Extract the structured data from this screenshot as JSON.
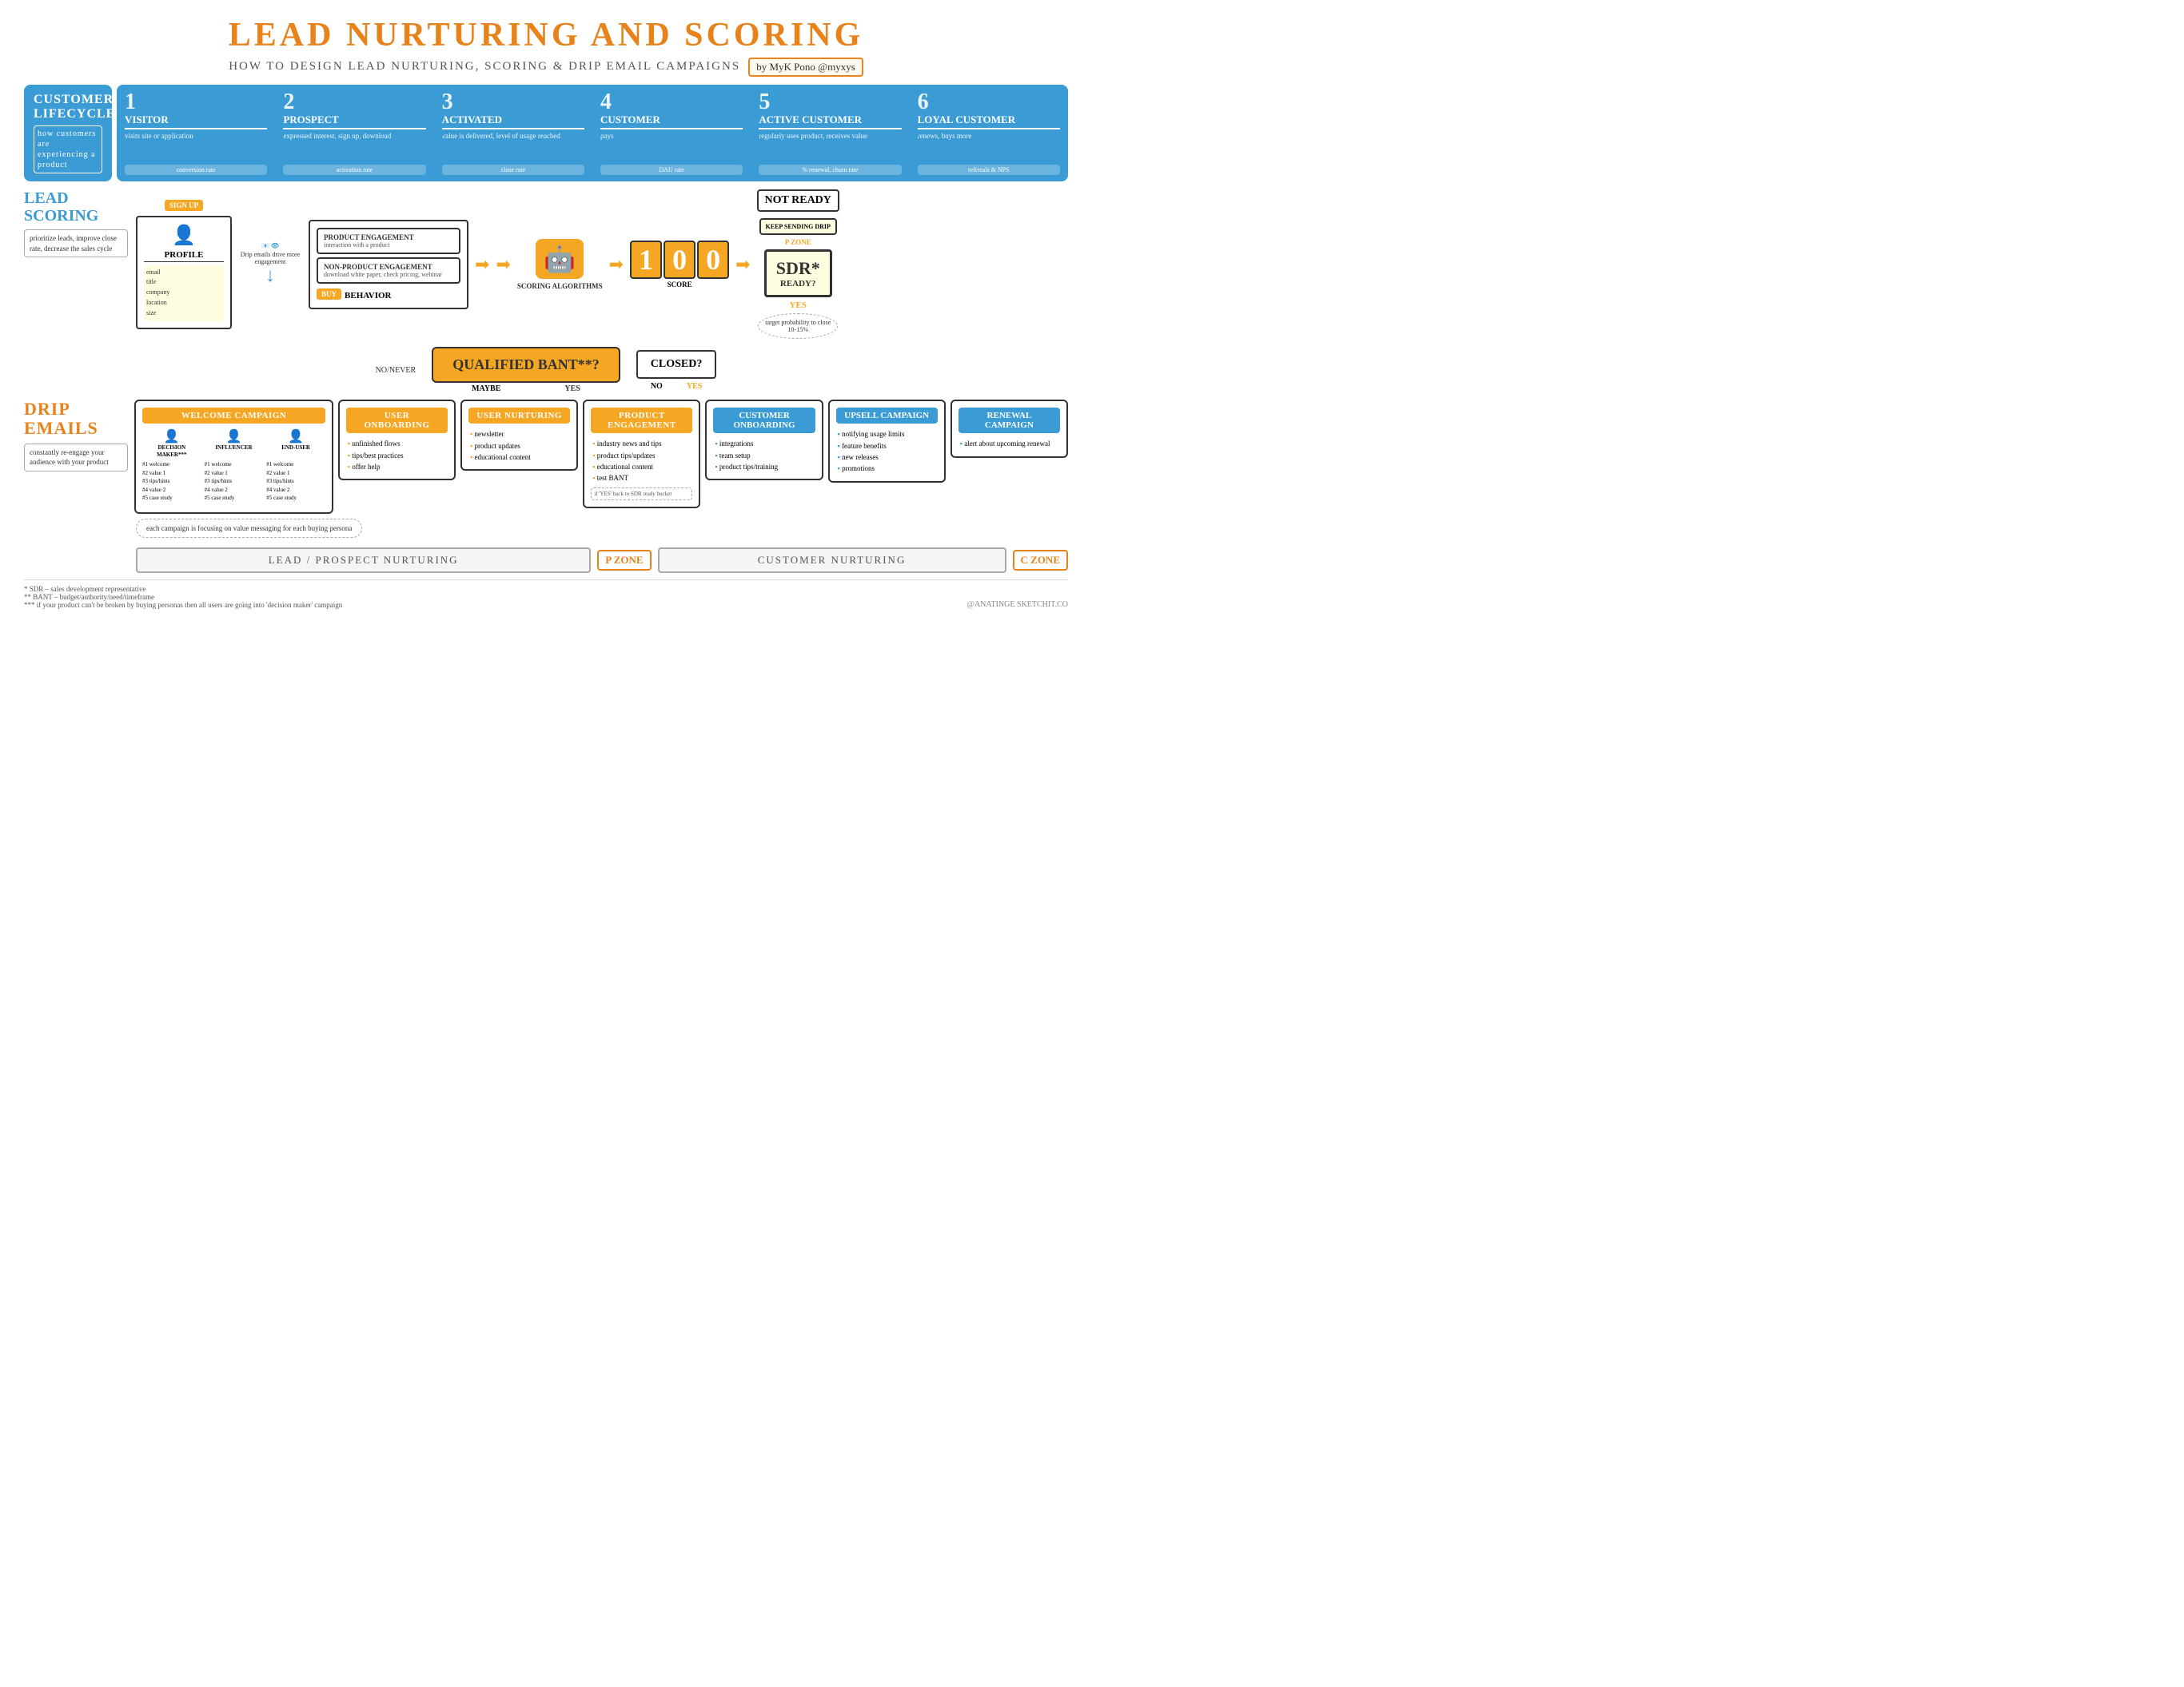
{
  "title": "LEAD NURTURING AND SCORING",
  "subtitle": "HOW TO DESIGN LEAD NURTURING, SCORING & DRIP EMAIL CAMPAIGNS",
  "author": "by MyK Pono @myxys",
  "lifecycle": {
    "label": "CUSTOMER LIFECYCLE",
    "sublabel": "how customers are experiencing a product",
    "steps": [
      {
        "num": "1",
        "name": "VISITOR",
        "desc": "visits site or application",
        "rate": "conversion rate"
      },
      {
        "num": "2",
        "name": "PROSPECT",
        "desc": "expressed interest, sign up, download",
        "rate": "activation rate"
      },
      {
        "num": "3",
        "name": "ACTIVATED",
        "desc": "value is delivered, level of usage reached",
        "rate": "close rate"
      },
      {
        "num": "4",
        "name": "CUSTOMER",
        "desc": "pays",
        "rate": "DAU rate"
      },
      {
        "num": "5",
        "name": "ACTIVE CUSTOMER",
        "desc": "regularly uses product, receives value",
        "rate": "% renewal, churn rate"
      },
      {
        "num": "6",
        "name": "LOYAL CUSTOMER",
        "desc": "renews, buys more",
        "rate": "referrals & NPS"
      }
    ]
  },
  "lead_scoring": {
    "title": "LEAD SCORING",
    "desc": "prioritize leads, improve close rate, decrease the sales cycle"
  },
  "flow": {
    "profile_label": "PROFILE",
    "profile_fields": "email\ntitle\ncompany\nlocation\nsize",
    "drip_label": "Drip emails drive more engagement",
    "signup_label": "SIGN UP",
    "product_engagement_title": "PRODUCT ENGAGEMENT",
    "product_engagement_sub": "interaction with a product",
    "non_product_title": "NON-PRODUCT ENGAGEMENT",
    "non_product_sub": "download white paper, check pricing, webinar",
    "behavior_label": "BEHAVIOR",
    "buy_label": "BUY",
    "scoring_algorithms": "SCORING ALGORITHMS",
    "score_label": "SCORE",
    "score_digits": [
      "1",
      "0",
      "0"
    ],
    "not_ready": "NOT READY",
    "keep_drip": "KEEP SENDING DRIP",
    "p_zone": "P ZONE",
    "sdr_title": "SDR*",
    "sdr_sub": "READY?",
    "sdr_yes": "YES",
    "target_cloud": "target probability to close 10-15%"
  },
  "bant": {
    "question": "QUALIFIED BANT**?",
    "yes": "YES",
    "no_never": "NO/NEVER",
    "maybe": "MAYBE",
    "closed_question": "CLOSED?",
    "closed_yes": "YES",
    "closed_no": "NO"
  },
  "campaigns": {
    "welcome": {
      "title": "WELCOME CAMPAIGN",
      "personas": [
        {
          "icon": "👤",
          "name": "DECISION MAKER***",
          "items": [
            "#1 welcome",
            "#2 value 1",
            "#3 tips/hints",
            "#4 value 2",
            "#5 case study"
          ]
        },
        {
          "icon": "👤",
          "name": "INFLUENCER",
          "items": [
            "#1 welcome",
            "#2 value 1",
            "#3 tips/hints",
            "#4 value 2",
            "#5 case study"
          ]
        },
        {
          "icon": "👤",
          "name": "END-USER",
          "items": [
            "#1 welcome",
            "#2 value 1",
            "#3 tips/hints",
            "#4 value 2",
            "#5 case study"
          ]
        }
      ]
    },
    "user_onboarding": {
      "title": "USER ONBOARDING",
      "items": [
        "unfinished flows",
        "tips/best practices",
        "offer help"
      ]
    },
    "user_nurturing": {
      "title": "USER NURTURING",
      "items": [
        "newsletter",
        "product updates",
        "educational content"
      ]
    },
    "product_engagement": {
      "title": "PRODUCT ENGAGEMENT",
      "items": [
        "industry news and tips",
        "product tips/updates",
        "educational content",
        "test BANT"
      ]
    },
    "customer_onboarding": {
      "title": "CUSTOMER ONBOARDING",
      "items": [
        "integrations",
        "team setup",
        "product tips/training"
      ]
    },
    "upsell": {
      "title": "UPSELL CAMPAIGN",
      "items": [
        "notifying usage limits",
        "feature benefits",
        "new releases",
        "promotions"
      ]
    },
    "renewal": {
      "title": "RENEWAL CAMPAIGN",
      "items": [
        "alert about upcoming renewal"
      ]
    }
  },
  "drip_emails": {
    "title": "DRIP EMAILS",
    "desc": "constantly re-engage your audience with your product"
  },
  "zones": {
    "lead_nurturing_label": "LEAD / PROSPECT NURTURING",
    "p_zone": "P ZONE",
    "customer_nurturing": "CUSTOMER NURTURING",
    "c_zone": "C ZONE"
  },
  "footnotes": {
    "sdr": "* SDR – sales development representative",
    "bant": "** BANT – budget/authority/need/timeframe",
    "decision_maker": "*** if your product can't be broken by buying personas then all users are going into 'decision maker' campaign"
  },
  "watermark": "@ANATINGE SKETCHIT.CO",
  "each_campaign_note": "each campaign is focusing on value messaging for each buying persona",
  "if_yes_back": "if 'YES' back to SDR ready bucket"
}
